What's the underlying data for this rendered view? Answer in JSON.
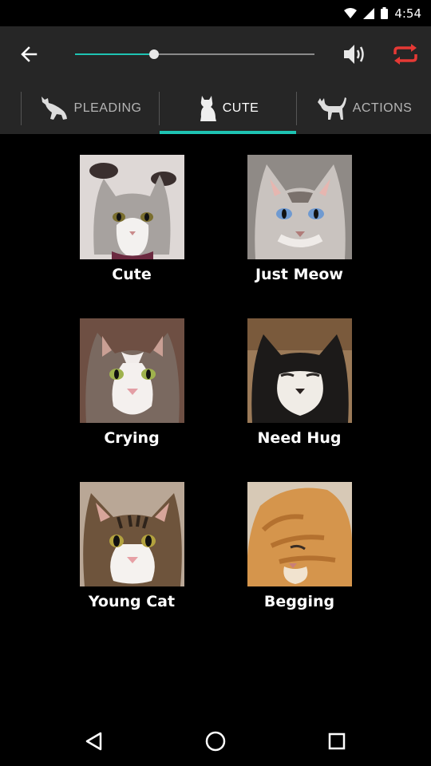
{
  "status_bar": {
    "time": "4:54"
  },
  "toolbar": {
    "seek_progress": 0.33
  },
  "tabs": [
    {
      "label": "PLEADING",
      "icon": "pleading-cat-icon",
      "selected": false
    },
    {
      "label": "CUTE",
      "icon": "sitting-cat-icon",
      "selected": true
    },
    {
      "label": "ACTIONS",
      "icon": "walking-cat-icon",
      "selected": false
    }
  ],
  "sounds": [
    {
      "label": "Cute"
    },
    {
      "label": "Just Meow"
    },
    {
      "label": "Crying"
    },
    {
      "label": "Need Hug"
    },
    {
      "label": "Young Cat"
    },
    {
      "label": "Begging"
    }
  ],
  "colors": {
    "accent": "#1ec3b3",
    "repeat": "#e53935"
  }
}
